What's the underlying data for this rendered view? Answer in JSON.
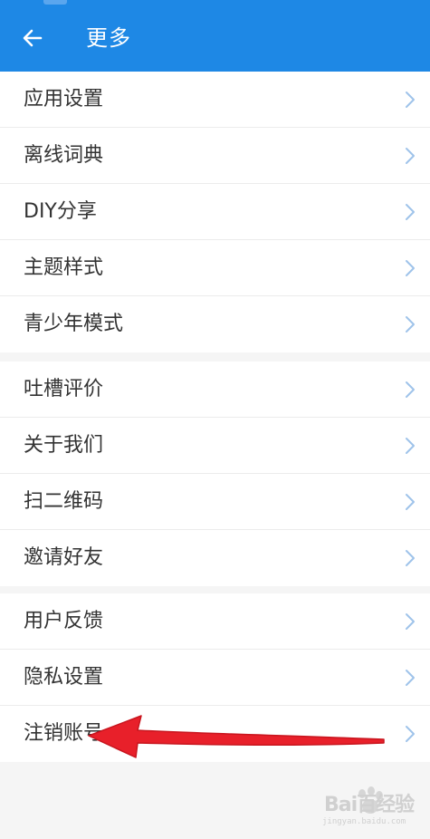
{
  "header": {
    "title": "更多",
    "back_icon": "arrow-left-icon"
  },
  "groups": [
    {
      "items": [
        {
          "label": "应用设置"
        },
        {
          "label": "离线词典"
        },
        {
          "label": "DIY分享"
        },
        {
          "label": "主题样式"
        },
        {
          "label": "青少年模式"
        }
      ]
    },
    {
      "items": [
        {
          "label": "吐槽评价"
        },
        {
          "label": "关于我们"
        },
        {
          "label": "扫二维码"
        },
        {
          "label": "邀请好友"
        }
      ]
    },
    {
      "items": [
        {
          "label": "用户反馈"
        },
        {
          "label": "隐私设置"
        },
        {
          "label": "注销账号"
        }
      ]
    }
  ],
  "annotation": {
    "arrow_color": "#e8202a"
  },
  "watermark": {
    "text": "Bai百经验",
    "sub": "jingyan.baidu.com"
  },
  "colors": {
    "header_bg": "#1e88e5",
    "page_bg": "#f5f5f5",
    "chevron": "#9fc3ea"
  }
}
